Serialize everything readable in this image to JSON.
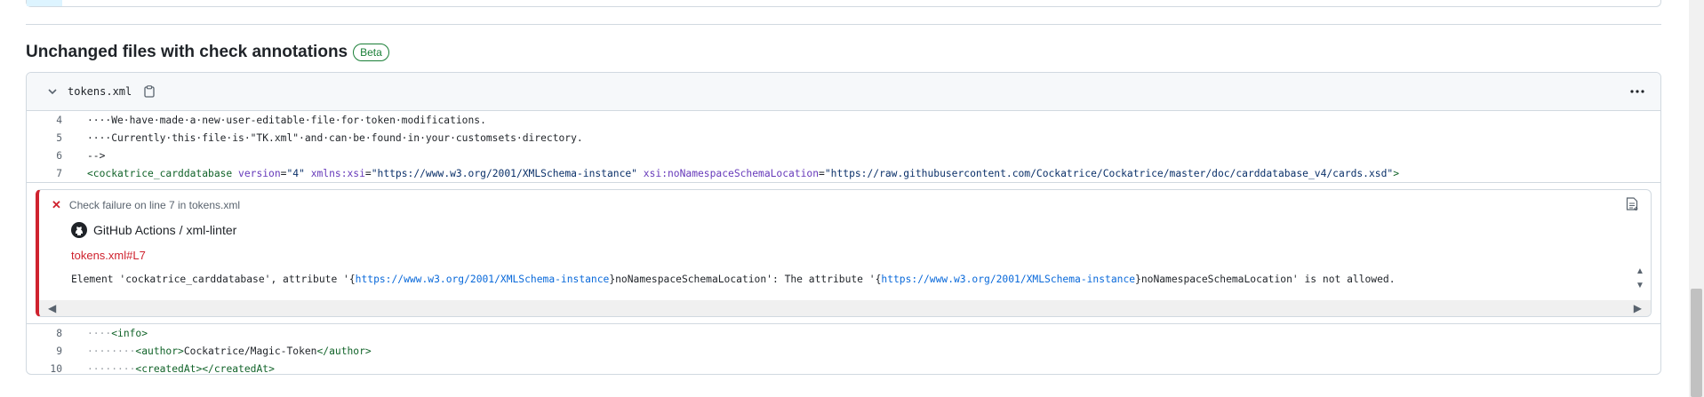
{
  "section": {
    "title": "Unchanged files with check annotations",
    "badge": "Beta"
  },
  "file": {
    "name": "tokens.xml",
    "icons": {
      "toggle": "chevron-down-icon",
      "copy": "copy-icon",
      "menu": "kebab-horizontal-icon"
    }
  },
  "code_before": [
    {
      "ln": "4",
      "text": "····We·have·made·a·new·user-editable·file·for·token·modifications."
    },
    {
      "ln": "5",
      "text": "····Currently·this·file·is·\"TK.xml\"·and·can·be·found·in·your·customsets·directory."
    },
    {
      "ln": "6",
      "text": "-->"
    },
    {
      "ln": "7",
      "parts": {
        "tag_open": "<cockatrice_carddatabase",
        "attr1": "version",
        "val1": "\"4\"",
        "attr2": "xmlns:xsi",
        "val2": "\"https://www.w3.org/2001/XMLSchema-instance\"",
        "attr3": "xsi:noNamespaceSchemaLocation",
        "val3": "\"https://raw.githubusercontent.com/Cockatrice/Cockatrice/master/doc/carddatabase_v4/cards.xsd\"",
        "tag_close": ">"
      }
    }
  ],
  "annotation": {
    "title": "Check failure on line 7 in tokens.xml",
    "source": "GitHub Actions",
    "separator": "/",
    "workflow": "xml-linter",
    "link": "tokens.xml#L7",
    "message_parts": [
      "Element 'cockatrice_carddatabase', attribute '{",
      "https://www.w3.org/2001/XMLSchema-instance",
      "}noNamespaceSchemaLocation': The attribute '{",
      "https://www.w3.org/2001/XMLSchema-instance",
      "}noNamespaceSchemaLocation' is not allowed."
    ],
    "icons": {
      "status": "x-icon",
      "app": "github-logo-icon",
      "raw": "file-log-icon"
    },
    "status_color": "#cf222e"
  },
  "code_after": [
    {
      "ln": "8",
      "indent": "····",
      "open": "<info",
      "close": ">",
      "content": ""
    },
    {
      "ln": "9",
      "indent": "········",
      "open": "<author",
      "close": ">",
      "content": "Cockatrice/Magic-Token",
      "end": "</author>"
    },
    {
      "ln": "10",
      "indent": "········",
      "open": "<createdAt",
      "close": ">",
      "content": "",
      "end": "</createdAt>"
    }
  ]
}
